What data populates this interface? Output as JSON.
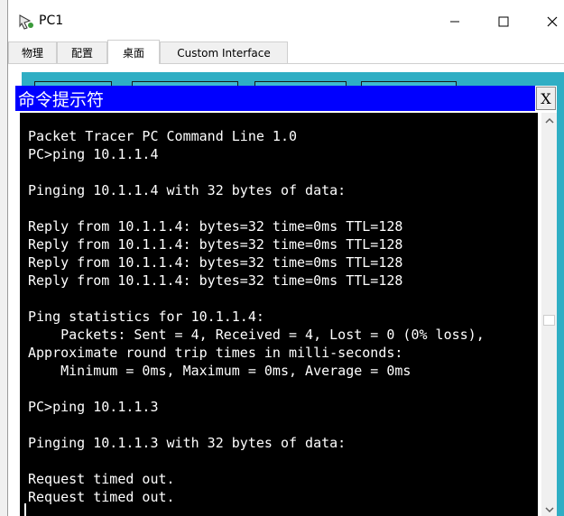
{
  "window": {
    "title": "PC1",
    "controls": [
      "minimize-icon",
      "maximize-icon",
      "close-icon"
    ]
  },
  "tabs": [
    {
      "label": "物理",
      "active": false
    },
    {
      "label": "配置",
      "active": false
    },
    {
      "label": "桌面",
      "active": true
    },
    {
      "label": "Custom Interface",
      "active": false
    }
  ],
  "cmd": {
    "title": "命令提示符",
    "close_label": "X",
    "lines": [
      "Packet Tracer PC Command Line 1.0",
      "PC>ping 10.1.1.4",
      "",
      "Pinging 10.1.1.4 with 32 bytes of data:",
      "",
      "Reply from 10.1.1.4: bytes=32 time=0ms TTL=128",
      "Reply from 10.1.1.4: bytes=32 time=0ms TTL=128",
      "Reply from 10.1.1.4: bytes=32 time=0ms TTL=128",
      "Reply from 10.1.1.4: bytes=32 time=0ms TTL=128",
      "",
      "Ping statistics for 10.1.1.4:",
      "    Packets: Sent = 4, Received = 4, Lost = 0 (0% loss),",
      "Approximate round trip times in milli-seconds:",
      "    Minimum = 0ms, Maximum = 0ms, Average = 0ms",
      "",
      "PC>ping 10.1.1.3",
      "",
      "Pinging 10.1.1.3 with 32 bytes of data:",
      "",
      "Request timed out.",
      "Request timed out."
    ]
  },
  "colors": {
    "cmd_title_bg": "#0000ff",
    "desktop_bg": "#2faec4",
    "terminal_bg": "#000000",
    "terminal_fg": "#ffffff"
  }
}
